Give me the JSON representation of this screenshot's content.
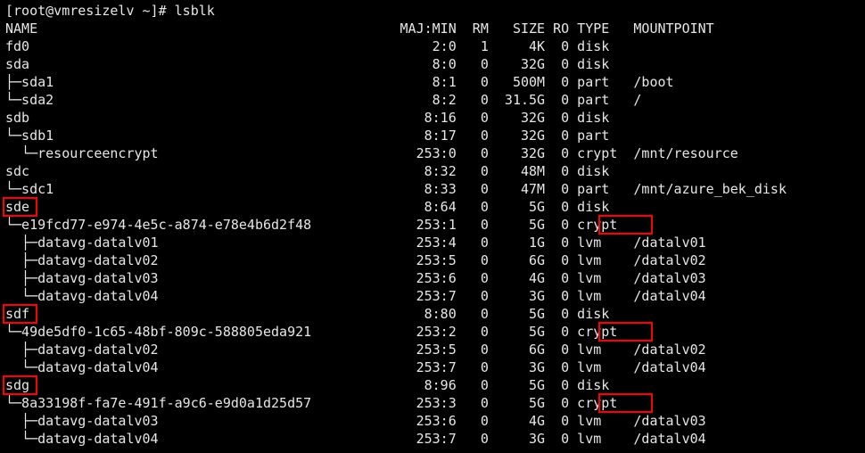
{
  "prompt": "[root@vmresizelv ~]# ",
  "command": "lsblk",
  "header": {
    "name": "NAME",
    "majmin": "MAJ:MIN",
    "rm": "RM",
    "size": "SIZE",
    "ro": "RO",
    "type": "TYPE",
    "mount": "MOUNTPOINT"
  },
  "rows": [
    {
      "tree": "",
      "name": "fd0",
      "majmin": "2:0",
      "rm": "1",
      "size": "4K",
      "ro": "0",
      "type": "disk",
      "mount": ""
    },
    {
      "tree": "",
      "name": "sda",
      "majmin": "8:0",
      "rm": "0",
      "size": "32G",
      "ro": "0",
      "type": "disk",
      "mount": ""
    },
    {
      "tree": "├─",
      "name": "sda1",
      "majmin": "8:1",
      "rm": "0",
      "size": "500M",
      "ro": "0",
      "type": "part",
      "mount": "/boot"
    },
    {
      "tree": "└─",
      "name": "sda2",
      "majmin": "8:2",
      "rm": "0",
      "size": "31.5G",
      "ro": "0",
      "type": "part",
      "mount": "/"
    },
    {
      "tree": "",
      "name": "sdb",
      "majmin": "8:16",
      "rm": "0",
      "size": "32G",
      "ro": "0",
      "type": "disk",
      "mount": ""
    },
    {
      "tree": "└─",
      "name": "sdb1",
      "majmin": "8:17",
      "rm": "0",
      "size": "32G",
      "ro": "0",
      "type": "part",
      "mount": ""
    },
    {
      "tree": "  └─",
      "name": "resourceencrypt",
      "majmin": "253:0",
      "rm": "0",
      "size": "32G",
      "ro": "0",
      "type": "crypt",
      "mount": "/mnt/resource"
    },
    {
      "tree": "",
      "name": "sdc",
      "majmin": "8:32",
      "rm": "0",
      "size": "48M",
      "ro": "0",
      "type": "disk",
      "mount": ""
    },
    {
      "tree": "└─",
      "name": "sdc1",
      "majmin": "8:33",
      "rm": "0",
      "size": "47M",
      "ro": "0",
      "type": "part",
      "mount": "/mnt/azure_bek_disk"
    },
    {
      "tree": "",
      "name": "sde",
      "majmin": "8:64",
      "rm": "0",
      "size": "5G",
      "ro": "0",
      "type": "disk",
      "mount": ""
    },
    {
      "tree": "└─",
      "name": "e19fcd77-e974-4e5c-a874-e78e4b6d2f48",
      "majmin": "253:1",
      "rm": "0",
      "size": "5G",
      "ro": "0",
      "type": "crypt",
      "mount": ""
    },
    {
      "tree": "  ├─",
      "name": "datavg-datalv01",
      "majmin": "253:4",
      "rm": "0",
      "size": "1G",
      "ro": "0",
      "type": "lvm",
      "mount": "/datalv01"
    },
    {
      "tree": "  ├─",
      "name": "datavg-datalv02",
      "majmin": "253:5",
      "rm": "0",
      "size": "6G",
      "ro": "0",
      "type": "lvm",
      "mount": "/datalv02"
    },
    {
      "tree": "  ├─",
      "name": "datavg-datalv03",
      "majmin": "253:6",
      "rm": "0",
      "size": "4G",
      "ro": "0",
      "type": "lvm",
      "mount": "/datalv03"
    },
    {
      "tree": "  └─",
      "name": "datavg-datalv04",
      "majmin": "253:7",
      "rm": "0",
      "size": "3G",
      "ro": "0",
      "type": "lvm",
      "mount": "/datalv04"
    },
    {
      "tree": "",
      "name": "sdf",
      "majmin": "8:80",
      "rm": "0",
      "size": "5G",
      "ro": "0",
      "type": "disk",
      "mount": ""
    },
    {
      "tree": "└─",
      "name": "49de5df0-1c65-48bf-809c-588805eda921",
      "majmin": "253:2",
      "rm": "0",
      "size": "5G",
      "ro": "0",
      "type": "crypt",
      "mount": ""
    },
    {
      "tree": "  ├─",
      "name": "datavg-datalv02",
      "majmin": "253:5",
      "rm": "0",
      "size": "6G",
      "ro": "0",
      "type": "lvm",
      "mount": "/datalv02"
    },
    {
      "tree": "  └─",
      "name": "datavg-datalv04",
      "majmin": "253:7",
      "rm": "0",
      "size": "3G",
      "ro": "0",
      "type": "lvm",
      "mount": "/datalv04"
    },
    {
      "tree": "",
      "name": "sdg",
      "majmin": "8:96",
      "rm": "0",
      "size": "5G",
      "ro": "0",
      "type": "disk",
      "mount": ""
    },
    {
      "tree": "└─",
      "name": "8a33198f-fa7e-491f-a9c6-e9d0a1d25d57",
      "majmin": "253:3",
      "rm": "0",
      "size": "5G",
      "ro": "0",
      "type": "crypt",
      "mount": ""
    },
    {
      "tree": "  ├─",
      "name": "datavg-datalv03",
      "majmin": "253:6",
      "rm": "0",
      "size": "4G",
      "ro": "0",
      "type": "lvm",
      "mount": "/datalv03"
    },
    {
      "tree": "  └─",
      "name": "datavg-datalv04",
      "majmin": "253:7",
      "rm": "0",
      "size": "3G",
      "ro": "0",
      "type": "lvm",
      "mount": "/datalv04"
    }
  ],
  "highlights": [
    {
      "label": "sde",
      "row": 11,
      "col_ch": 0,
      "w_ch": 3.7
    },
    {
      "label": "crypt",
      "row": 12,
      "col_ch": 74,
      "w_ch": 6.0
    },
    {
      "label": "sdf",
      "row": 17,
      "col_ch": 0,
      "w_ch": 3.7
    },
    {
      "label": "crypt",
      "row": 18,
      "col_ch": 74,
      "w_ch": 6.0
    },
    {
      "label": "sdg",
      "row": 21,
      "col_ch": 0,
      "w_ch": 3.7
    },
    {
      "label": "crypt",
      "row": 22,
      "col_ch": 74,
      "w_ch": 6.0
    }
  ],
  "cols": {
    "name_width": 48,
    "majmin_width": 8,
    "rm_width": 4,
    "size_width": 7,
    "ro_width": 3,
    "type_width": 6
  }
}
